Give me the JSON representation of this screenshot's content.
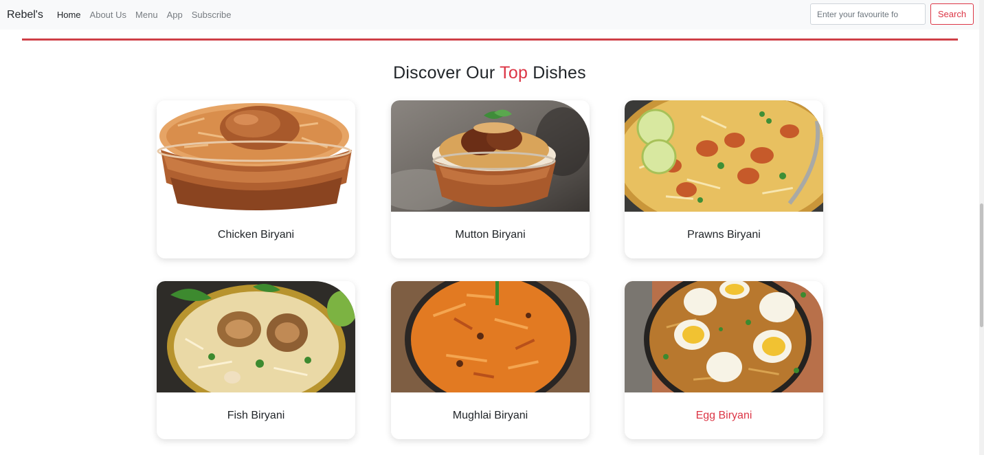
{
  "navbar": {
    "brand": "Rebel's",
    "links": [
      {
        "label": "Home",
        "active": true
      },
      {
        "label": "About Us"
      },
      {
        "label": "Menu"
      },
      {
        "label": "App"
      },
      {
        "label": "Subscribe"
      }
    ],
    "search_placeholder": "Enter your favourite fo",
    "search_button": "Search"
  },
  "section": {
    "title_before": "Discover Our ",
    "title_accent": "Top",
    "title_after": " Dishes",
    "accent_color": "#dc3545"
  },
  "dishes": [
    {
      "name": "Chicken Biryani",
      "icon": "chicken-biryani-photo"
    },
    {
      "name": "Mutton Biryani",
      "icon": "mutton-biryani-photo"
    },
    {
      "name": "Prawns Biryani",
      "icon": "prawns-biryani-photo"
    },
    {
      "name": "Fish Biryani",
      "icon": "fish-biryani-photo"
    },
    {
      "name": "Mughlai Biryani",
      "icon": "mughlai-biryani-photo"
    },
    {
      "name": "Egg Biryani",
      "icon": "egg-biryani-photo",
      "highlighted": true
    }
  ]
}
